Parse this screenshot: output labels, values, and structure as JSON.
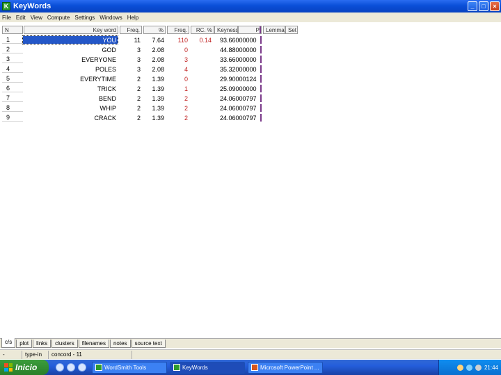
{
  "window": {
    "title": "KeyWords",
    "app_letter": "K"
  },
  "menu": [
    "File",
    "Edit",
    "View",
    "Compute",
    "Settings",
    "Windows",
    "Help"
  ],
  "columns": {
    "n": "N",
    "keyword": "Key word",
    "freq": "Freq.",
    "pct": "%",
    "fr2": "Freq.",
    "rc": "RC. %",
    "keyness": "Keyness",
    "p": "P",
    "lemmas": "Lemmas",
    "set": "Set"
  },
  "rows": [
    {
      "n": "1",
      "keyword": "YOU",
      "freq": "11",
      "pct": "7.64",
      "fr2": "110",
      "rc": "0.14",
      "keyness": "93.66000000"
    },
    {
      "n": "2",
      "keyword": "GOD",
      "freq": "3",
      "pct": "2.08",
      "fr2": "0",
      "rc": "",
      "keyness": "44.88000000"
    },
    {
      "n": "3",
      "keyword": "EVERYONE",
      "freq": "3",
      "pct": "2.08",
      "fr2": "3",
      "rc": "",
      "keyness": "33.66000000"
    },
    {
      "n": "4",
      "keyword": "POLES",
      "freq": "3",
      "pct": "2.08",
      "fr2": "4",
      "rc": "",
      "keyness": "35.32000000"
    },
    {
      "n": "5",
      "keyword": "EVERYTIME",
      "freq": "2",
      "pct": "1.39",
      "fr2": "0",
      "rc": "",
      "keyness": "29.90000124"
    },
    {
      "n": "6",
      "keyword": "TRICK",
      "freq": "2",
      "pct": "1.39",
      "fr2": "1",
      "rc": "",
      "keyness": "25.09000000"
    },
    {
      "n": "7",
      "keyword": "BEND",
      "freq": "2",
      "pct": "1.39",
      "fr2": "2",
      "rc": "",
      "keyness": "24.06000797"
    },
    {
      "n": "8",
      "keyword": "WHIP",
      "freq": "2",
      "pct": "1.39",
      "fr2": "2",
      "rc": "",
      "keyness": "24.06000797"
    },
    {
      "n": "9",
      "keyword": "CRACK",
      "freq": "2",
      "pct": "1.39",
      "fr2": "2",
      "rc": "",
      "keyness": "24.06000797"
    }
  ],
  "tabs": [
    "c/s",
    "plot",
    "links",
    "clusters",
    "filenames",
    "notes",
    "source text"
  ],
  "active_tab": "c/s",
  "status": {
    "left": "-",
    "mode": "type-in",
    "info": "concord - 11"
  },
  "taskbar": {
    "start_label": "Inicio",
    "tasks": [
      {
        "label": "WordSmith Tools",
        "kind": "ws"
      },
      {
        "label": "KeyWords",
        "kind": "ws",
        "active": true
      },
      {
        "label": "Microsoft PowerPoint ...",
        "kind": "ppt"
      }
    ],
    "clock": "21:44"
  }
}
